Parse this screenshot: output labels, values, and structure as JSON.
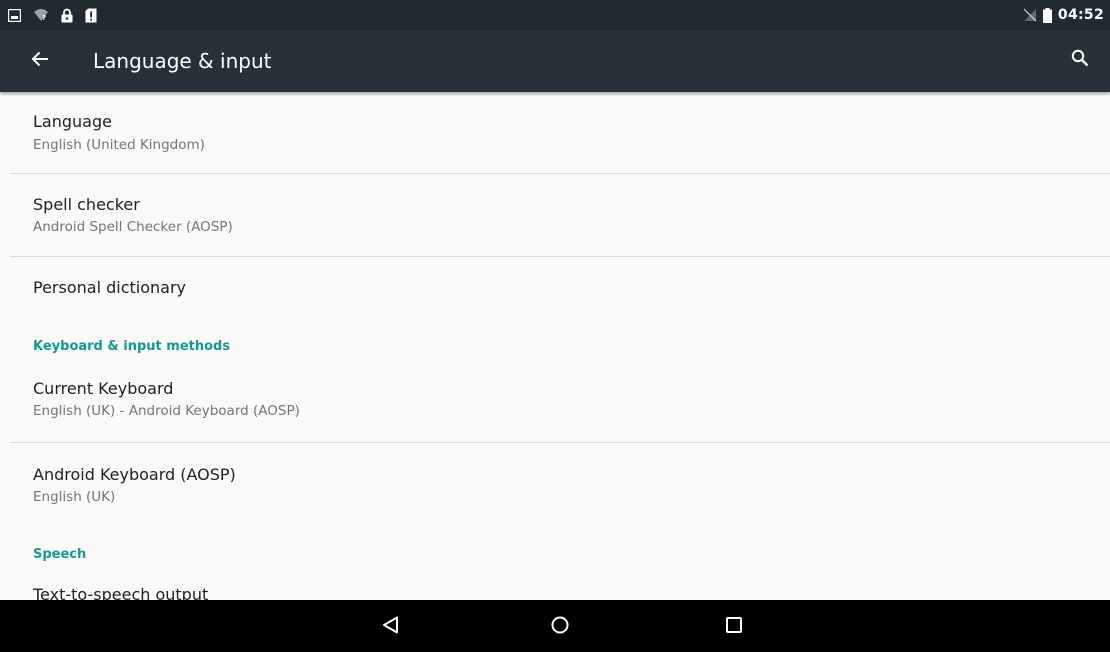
{
  "status_bar": {
    "time": "04:52",
    "left_icons": [
      "image-notification-icon",
      "wifi-question-icon",
      "lock-icon",
      "sim-alert-icon"
    ],
    "right_icons": [
      "no-sim-icon",
      "battery-icon"
    ]
  },
  "app_bar": {
    "back_icon": "arrow-back-icon",
    "title": "Language & input",
    "search_icon": "search-icon",
    "background": "#263238"
  },
  "items": [
    {
      "title": "Language",
      "summary": "English (United Kingdom)"
    },
    {
      "title": "Spell checker",
      "summary": "Android Spell Checker (AOSP)"
    },
    {
      "title": "Personal dictionary"
    }
  ],
  "keyboard_section": {
    "header": "Keyboard & input methods",
    "items": [
      {
        "title": "Current Keyboard",
        "summary": "English (UK) - Android Keyboard (AOSP)"
      },
      {
        "title": "Android Keyboard (AOSP)",
        "summary": "English (UK)"
      }
    ]
  },
  "speech_section": {
    "header": "Speech",
    "items": [
      {
        "title": "Text-to-speech output"
      }
    ]
  },
  "nav_bar": {
    "buttons": [
      "back-triangle-icon",
      "home-circle-icon",
      "recents-square-icon"
    ]
  },
  "colors": {
    "accent": "#159a8e",
    "status_bar": "#1f2b30",
    "nav_bar": "#000000",
    "background": "#fafafa"
  }
}
